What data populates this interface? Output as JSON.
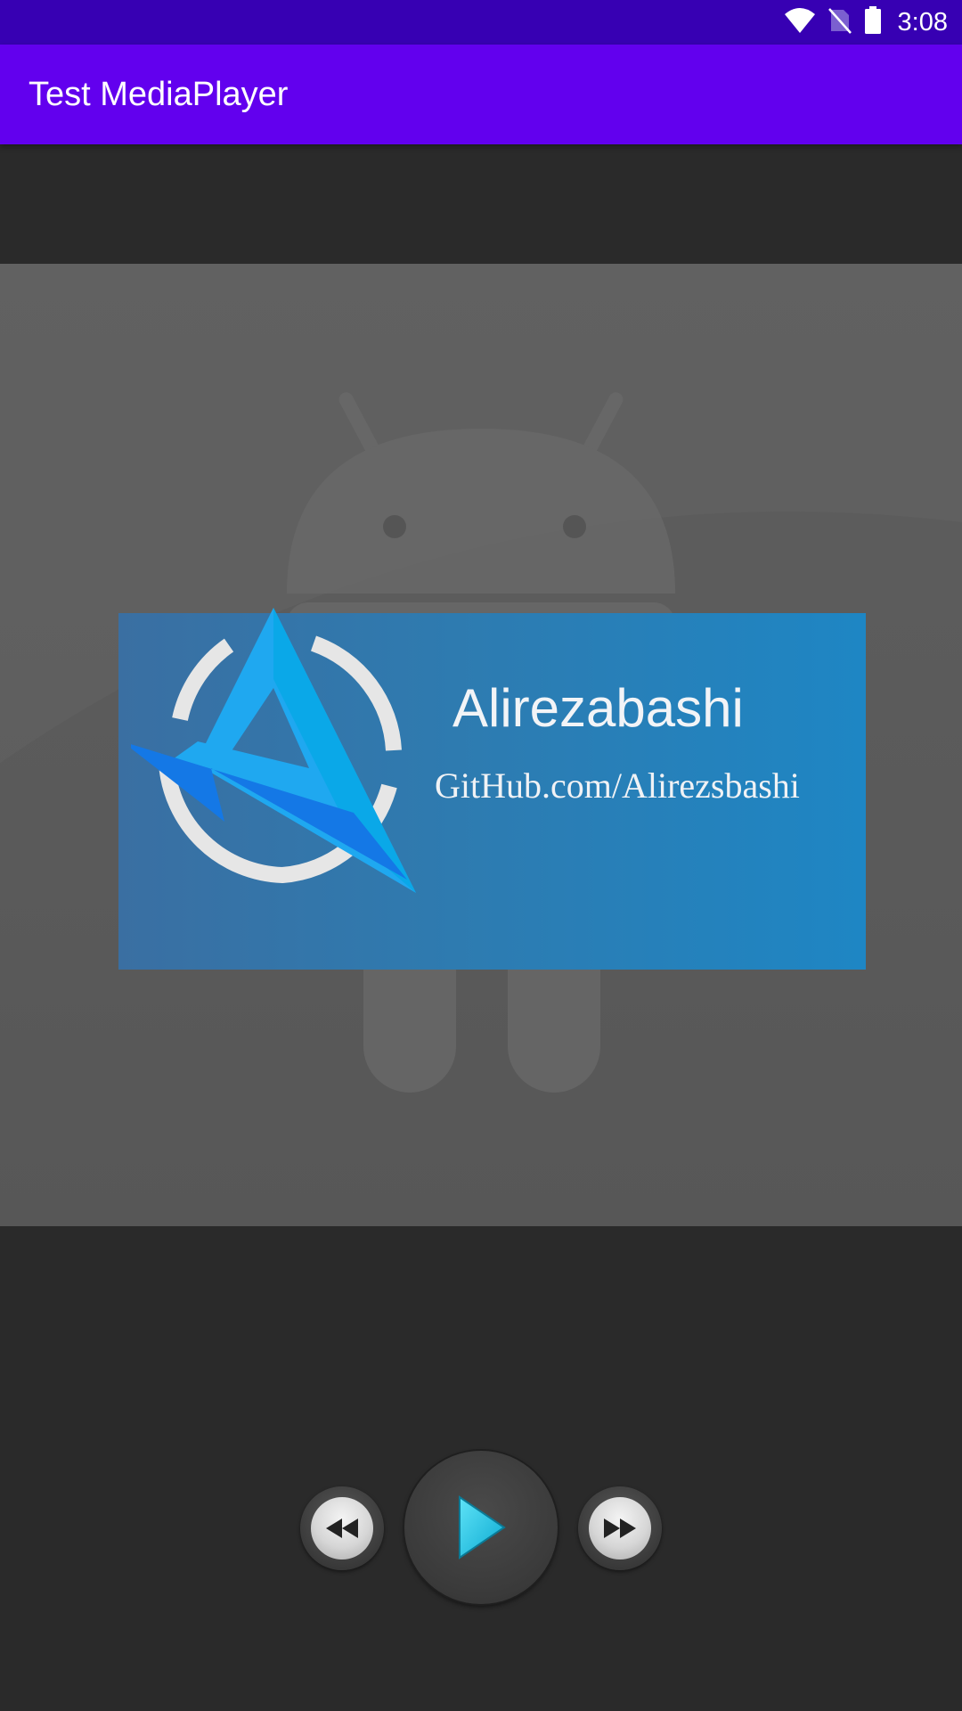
{
  "status_bar": {
    "time": "3:08",
    "icons": [
      "wifi-icon",
      "no-sim-icon",
      "battery-icon"
    ]
  },
  "app_bar": {
    "title": "Test MediaPlayer"
  },
  "artwork": {
    "banner_title": "Alirezabashi",
    "banner_subtitle": "GitHub.com/Alirezsbashi"
  },
  "controls": {
    "rewind": "rewind-icon",
    "play": "play-icon",
    "fast_forward": "fast-forward-icon",
    "accent_color": "#1ec8e6"
  },
  "colors": {
    "status_bar": "#3700b3",
    "app_bar": "#6200ee",
    "background": "#2a2a2a"
  }
}
